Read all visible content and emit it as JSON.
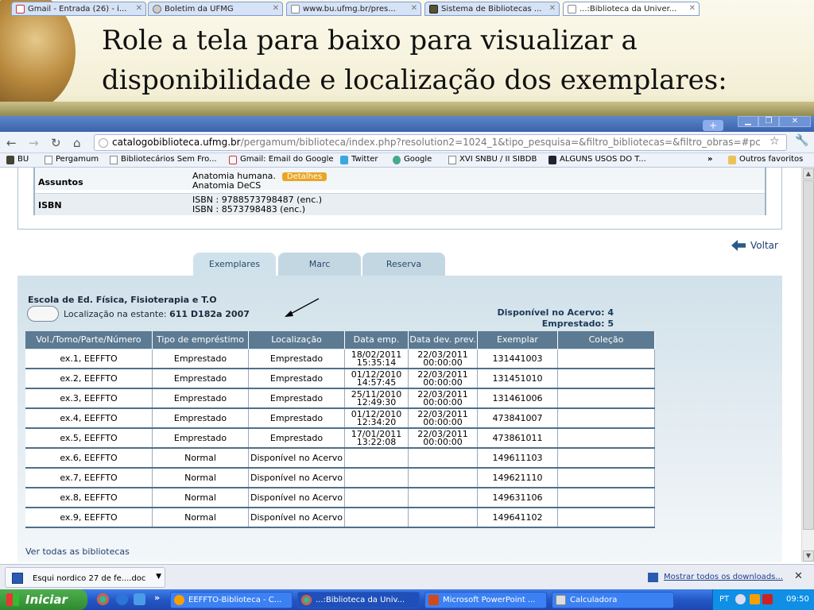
{
  "slide": {
    "title_line1": "Role a tela para baixo para visualizar a",
    "title_line2": "disponibilidade e localização dos exemplares:"
  },
  "browser": {
    "tabs": [
      {
        "label": "Gmail - Entrada (26) - i...",
        "icon": "gmail-icon",
        "active": false
      },
      {
        "label": "Boletim da UFMG",
        "icon": "page-icon",
        "active": false
      },
      {
        "label": "www.bu.ufmg.br/pres...",
        "icon": "page-icon",
        "active": false
      },
      {
        "label": "Sistema de Bibliotecas ...",
        "icon": "page-icon",
        "active": false
      },
      {
        "label": "...:Biblioteca da Univer...",
        "icon": "page-icon",
        "active": true
      }
    ],
    "url_host": "catalogobiblioteca.ufmg.br",
    "url_path": "/pergamum/biblioteca/index.php?resolution2=1024_1&tipo_pesquisa=&filtro_bibliotecas=&filtro_obras=#pc",
    "bookmarks": [
      {
        "label": "BU"
      },
      {
        "label": "Pergamum"
      },
      {
        "label": "Bibliotecários Sem Fro..."
      },
      {
        "label": "Gmail: Email do Google"
      },
      {
        "label": "Twitter"
      },
      {
        "label": "Google"
      },
      {
        "label": "XVI SNBU / II SIBDB"
      },
      {
        "label": "ALGUNS USOS DO T..."
      }
    ],
    "bookmarks_more": "»",
    "other_bookmarks": "Outros favoritos"
  },
  "record": {
    "assuntos_label": "Assuntos",
    "assuntos_values": [
      "Anatomia humana.",
      "Anatomia DeCS"
    ],
    "detalhes_label": "Detalhes",
    "isbn_label": "ISBN",
    "isbn_values": [
      "ISBN : 9788573798487 (enc.)",
      "ISBN : 8573798483 (enc.)"
    ],
    "voltar_label": "Voltar"
  },
  "detail_tabs": [
    "Exemplares",
    "Marc",
    "Reserva"
  ],
  "holdings": {
    "library": "Escola de Ed. Física, Fisioterapia e T.O",
    "location_prefix": "Localização na estante:",
    "location_code": "611 D182a 2007",
    "available": "Disponível no Acervo: 4",
    "borrowed": "Emprestado: 5",
    "columns": [
      "Vol./Tomo/Parte/Número",
      "Tipo de empréstimo",
      "Localização",
      "Data emp.",
      "Data dev. prev.",
      "Exemplar",
      "Coleção"
    ],
    "rows": [
      [
        "ex.1, EEFFTO",
        "Emprestado",
        "Emprestado",
        "18/02/2011 15:35:14",
        "22/03/2011 00:00:00",
        "131441003",
        ""
      ],
      [
        "ex.2, EEFFTO",
        "Emprestado",
        "Emprestado",
        "01/12/2010 14:57:45",
        "22/03/2011 00:00:00",
        "131451010",
        ""
      ],
      [
        "ex.3, EEFFTO",
        "Emprestado",
        "Emprestado",
        "25/11/2010 12:49:30",
        "22/03/2011 00:00:00",
        "131461006",
        ""
      ],
      [
        "ex.4, EEFFTO",
        "Emprestado",
        "Emprestado",
        "01/12/2010 12:34:20",
        "22/03/2011 00:00:00",
        "473841007",
        ""
      ],
      [
        "ex.5, EEFFTO",
        "Emprestado",
        "Emprestado",
        "17/01/2011 13:22:08",
        "22/03/2011 00:00:00",
        "473861011",
        ""
      ],
      [
        "ex.6, EEFFTO",
        "Normal",
        "Disponível no Acervo",
        "",
        "",
        "149611103",
        ""
      ],
      [
        "ex.7, EEFFTO",
        "Normal",
        "Disponível no Acervo",
        "",
        "",
        "149621110",
        ""
      ],
      [
        "ex.8, EEFFTO",
        "Normal",
        "Disponível no Acervo",
        "",
        "",
        "149631106",
        ""
      ],
      [
        "ex.9, EEFFTO",
        "Normal",
        "Disponível no Acervo",
        "",
        "",
        "149641102",
        ""
      ]
    ],
    "see_all": "Ver todas as bibliotecas"
  },
  "downloads": {
    "file": "Esqui nordico  27 de fe....doc",
    "show_all": "Mostrar todos os downloads..."
  },
  "taskbar": {
    "start": "Iniciar",
    "more": "»",
    "tasks": [
      {
        "label": "EEFFTO-Biblioteca - C...",
        "active": false
      },
      {
        "label": "...:Biblioteca da Univ...",
        "active": true
      },
      {
        "label": "Microsoft PowerPoint ...",
        "active": false
      },
      {
        "label": "Calculadora",
        "active": false
      }
    ],
    "lang": "PT",
    "clock": "09:50"
  }
}
